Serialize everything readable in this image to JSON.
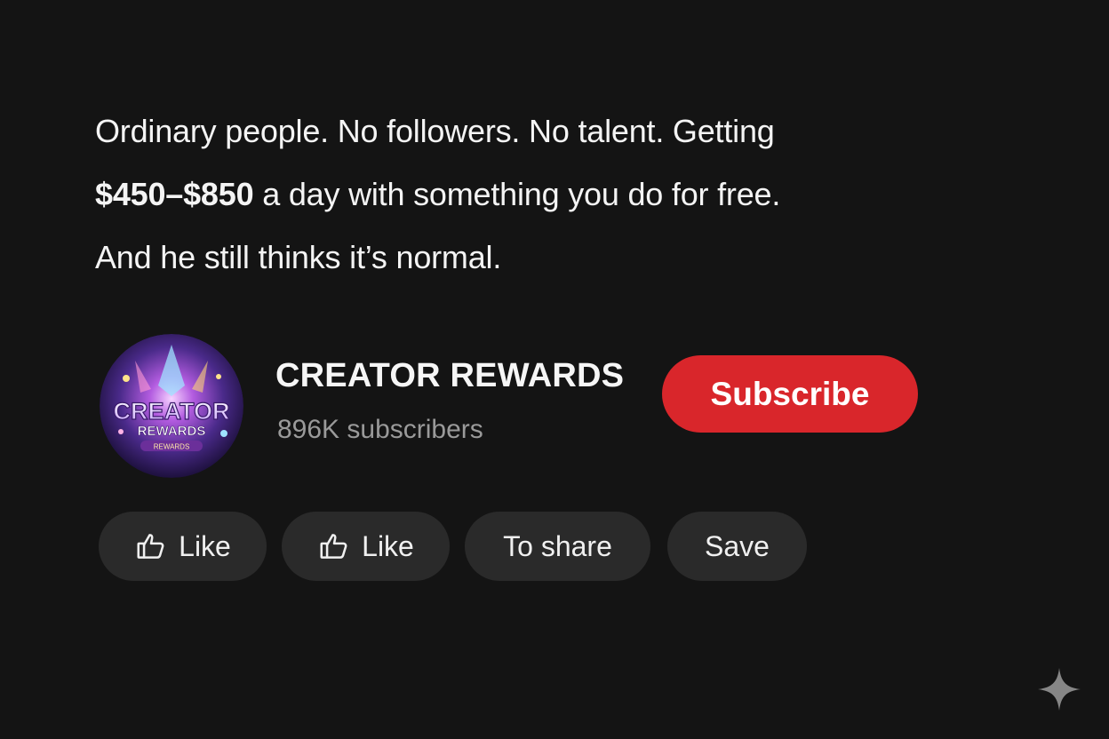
{
  "post": {
    "line1": "Ordinary people. No followers. No talent. Getting",
    "amount": "$450–$850",
    "line2_rest": " a day with something you do for free.",
    "line3": "And he still thinks it’s normal."
  },
  "channel": {
    "avatar_text_top": "CREATOR",
    "avatar_text_bottom": "REWARDS",
    "avatar_text_small": "REWARDS",
    "name": "CREATOR REWARDS",
    "subscribers": "896K subscribers"
  },
  "subscribe": {
    "label": "Subscribe",
    "color": "#d9262b"
  },
  "actions": [
    {
      "label": "Like",
      "icon": "thumbs-up-icon"
    },
    {
      "label": "Like",
      "icon": "thumbs-up-icon"
    },
    {
      "label": "To share"
    },
    {
      "label": "Save"
    }
  ],
  "colors": {
    "background": "#141414",
    "pill": "#2a2a2a",
    "muted_text": "#9a9a9a"
  },
  "watermark": {
    "icon": "sparkle-icon"
  }
}
